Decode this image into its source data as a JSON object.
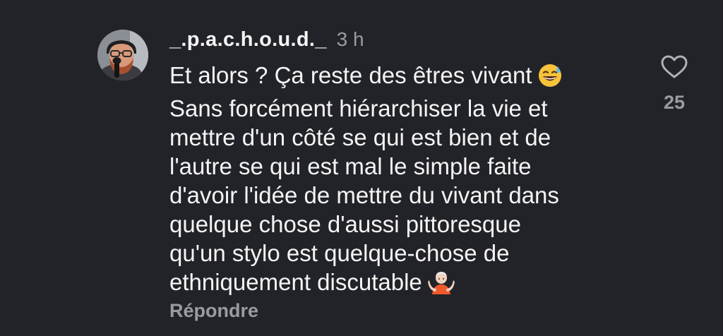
{
  "comment": {
    "username": "_.p.a.c.h.o.u.d._",
    "time": "3 h",
    "lines": [
      "Et alors ? Ça reste des êtres vivant",
      "Sans forcément hiérarchiser la vie et",
      "mettre d'un côté se qui est bien et de",
      "l'autre se qui est mal le simple faite",
      "d'avoir l'idée de mettre du vivant dans",
      "quelque chose d'aussi pittoresque",
      "qu'un stylo est quelque-chose de",
      "ethniquement discutable"
    ],
    "emojis": [
      "sweat-smile-emoji",
      "shrug-emoji"
    ],
    "reply_label": "Répondre",
    "like_count": "25",
    "like_icon": "heart-outline-icon"
  },
  "colors": {
    "background": "#222329",
    "primary_text": "#f4f4f4",
    "secondary_text": "#9a9ba1"
  }
}
